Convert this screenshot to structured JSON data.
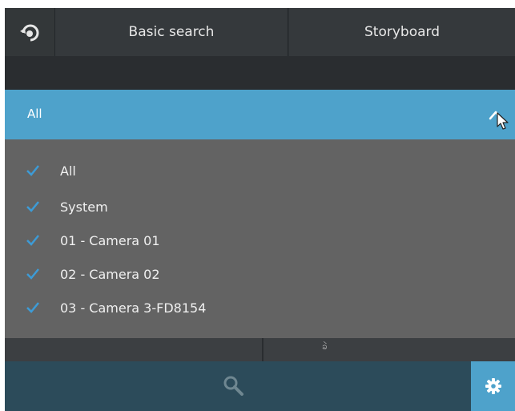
{
  "header": {
    "tabs": [
      {
        "label": "Basic search"
      },
      {
        "label": "Storyboard"
      }
    ]
  },
  "filter": {
    "selected": "All",
    "options": [
      {
        "label": "All",
        "checked": true
      },
      {
        "label": "System",
        "checked": true
      },
      {
        "label": "01 - Camera 01",
        "checked": true
      },
      {
        "label": "02 - Camera 02",
        "checked": true
      },
      {
        "label": "03 - Camera 3-FD8154",
        "checked": true
      }
    ]
  },
  "underlay": {
    "partial_text": "ခဲ"
  },
  "colors": {
    "accent": "#4ea2cb",
    "check": "#3d9bd6",
    "list_bg": "#636363",
    "bottom_bar": "#2c4b5a"
  },
  "icons": {
    "back": "back-arrow-icon",
    "collapse": "chevron-up-icon",
    "cursor": "mouse-cursor-icon",
    "check": "checkmark-icon",
    "search": "search-icon",
    "settings": "gear-icon"
  }
}
